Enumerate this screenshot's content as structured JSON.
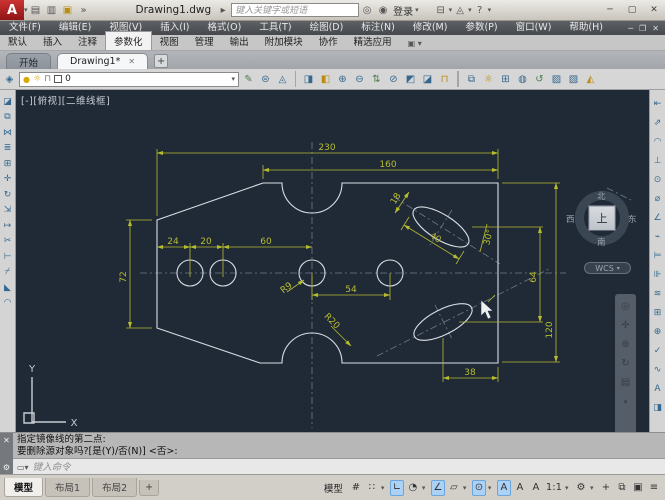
{
  "title_bar": {
    "document_title": "Drawing1.dwg",
    "search_placeholder": "键入关键字或短语",
    "sign_in_label": "登录"
  },
  "menu_bar": {
    "items": [
      "文件(F)",
      "编辑(E)",
      "视图(V)",
      "插入(I)",
      "格式(O)",
      "工具(T)",
      "绘图(D)",
      "标注(N)",
      "修改(M)",
      "参数(P)",
      "窗口(W)",
      "帮助(H)"
    ]
  },
  "ribbon": {
    "tabs": [
      "默认",
      "插入",
      "注释",
      "参数化",
      "视图",
      "管理",
      "输出",
      "附加模块",
      "协作",
      "精选应用"
    ],
    "active_tab": "参数化"
  },
  "file_tabs": {
    "items": [
      "开始",
      "Drawing1*"
    ],
    "new_tab_label": "+"
  },
  "layer_bar": {
    "current_layer": "0"
  },
  "viewport": {
    "label": "[-][俯视][二维线框]",
    "viewcube": {
      "north": "北",
      "south": "南",
      "west": "西",
      "east": "东",
      "top": "上",
      "wcs_label": "WCS"
    },
    "ucs": {
      "x_label": "X",
      "y_label": "Y"
    },
    "dims": {
      "total_width": "230",
      "upper_width": "160",
      "left_height": "72",
      "hole_offset": "24",
      "hole_spacing": "20",
      "hole_span": "60",
      "hole_span_right": "54",
      "slot_edge_offset": "38",
      "slot_center_span": "64",
      "right_height": "120",
      "slot_length": "40",
      "slot_width": "18",
      "slot_angle": "30°",
      "hole_radius": "R9",
      "notch_radius": "R20"
    }
  },
  "command_line": {
    "history_line_1": "指定镜像线的第二点:",
    "history_line_2": "要删除源对象吗?[是(Y)/否(N)] <否>:",
    "input_placeholder": "键入命令"
  },
  "status_bar": {
    "layout_tabs": [
      "模型",
      "布局1",
      "布局2"
    ],
    "new_layout_label": "+",
    "model_label": "模型",
    "scale_label": "1:1"
  }
}
